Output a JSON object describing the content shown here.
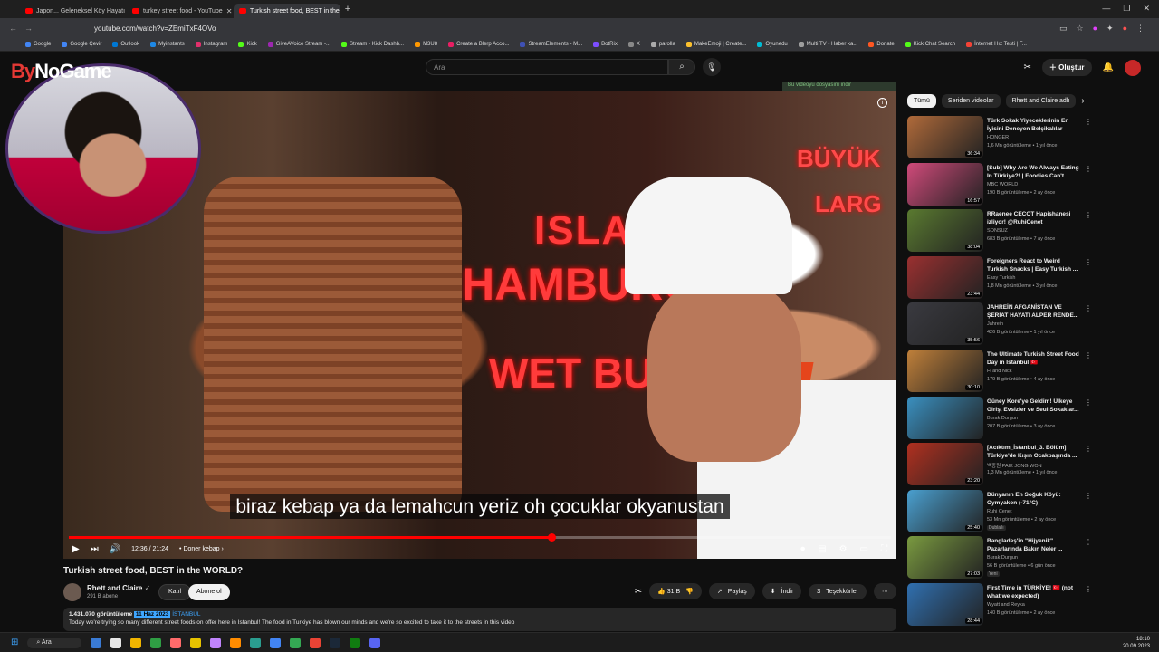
{
  "browser": {
    "tabs": [
      {
        "label": "Japon... Geleneksel Köy Hayatı",
        "active": false
      },
      {
        "label": "turkey street food - YouTube",
        "active": false
      },
      {
        "label": "Turkish street food, BEST in the",
        "active": true
      }
    ],
    "new_tab": "+",
    "url": "youtube.com/watch?v=ZEmiTxF4OVo",
    "bookmarks": [
      "Google",
      "Google Çevir",
      "Outlook",
      "Myinstants",
      "Instagram",
      "Kick",
      "GiveAVoice Stream -...",
      "Stream - Kick Dashb...",
      "M3U8",
      "Create a Blerp Acco...",
      "StreamElements - M...",
      "BotRix",
      "X",
      "parolla",
      "MakeEmoji | Create...",
      "Oyunedu",
      "Multi TV - Haber ka...",
      "Donate",
      "Kick Chat Search",
      "İnternet Hız Testi | F..."
    ]
  },
  "overlay": {
    "logo_prefix": "By",
    "logo_suffix": "NoGame"
  },
  "header": {
    "search_placeholder": "Ara",
    "create_label": "Oluştur"
  },
  "player": {
    "download_notice": "Bu videoyu dosyasını indir",
    "subtitle": "biraz kebap ya da lemahcun yeriz oh çocuklar okyanustan",
    "time": "12:36 / 21:24",
    "chapter": "Doner kebap",
    "progress": 0.587,
    "signs": [
      "ISLAK",
      "HAMBURG",
      "WET BURG",
      "BÜYÜK",
      "LARG"
    ]
  },
  "video": {
    "title": "Turkish street food, BEST in the WORLD?",
    "channel": "Rhett and Claire",
    "subscribers": "291 B abone",
    "join_label": "Katıl",
    "subscribe_label": "Abone ol",
    "likes": "31 B",
    "share_label": "Paylaş",
    "download_label": "İndir",
    "thanks_label": "Teşekkürler",
    "views": "1.431.070 görüntüleme",
    "date": "11 Haz 2023",
    "hashtag": "İSTANBUL",
    "description": "Today we're trying so many different street foods on offer here in Istanbul! The food in Turkiye has blown our minds and we're so excited to take it to the streets in this video"
  },
  "sidebar": {
    "chips": [
      "Tümü",
      "Seriden videolar",
      "Rhett and Claire adlı"
    ],
    "videos": [
      {
        "title": "Türk Sokak Yiyeceklerinin En İyisini Deneyen Belçikalılar",
        "channel": "HONGER",
        "meta": "1,6 Mn görüntüleme • 1 yıl önce",
        "duration": "36:34",
        "color": "#b06a3a"
      },
      {
        "title": "[Sub] Why Are We Always Eating In Türkiye?! | Foodies Can't ...",
        "channel": "MBC WORLD",
        "meta": "190 B görüntüleme • 2 ay önce",
        "duration": "16:57",
        "color": "#d04a7a"
      },
      {
        "title": "RRaenee CECOT Hapishanesi izliyor! @RuhiCenet",
        "channel": "SONSUZ",
        "meta": "683 B görüntüleme • 7 ay önce",
        "duration": "38:04",
        "color": "#5a7a30"
      },
      {
        "title": "Foreigners React to Weird Turkish Snacks | Easy Turkish ...",
        "channel": "Easy Turkish",
        "meta": "1,8 Mn görüntüleme • 3 yıl önce",
        "duration": "23:44",
        "color": "#9a3030"
      },
      {
        "title": "JAHREİN AFGANİSTAN VE ŞERİAT HAYATI ALPER RENDE...",
        "channel": "Jahrein",
        "meta": "426 B görüntüleme • 1 yıl önce",
        "duration": "35:56",
        "color": "#3a3a40"
      },
      {
        "title": "The Ultimate Turkish Street Food Day in Istanbul 🇹🇷",
        "channel": "Fi and Nick",
        "meta": "179 B görüntüleme • 4 ay önce",
        "duration": "30:10",
        "color": "#c0803a"
      },
      {
        "title": "Güney Kore'ye Geldim! Ülkeye Giriş, Evsizler ve Seul Sokaklar...",
        "channel": "Burak Durgun",
        "meta": "207 B görüntüleme • 3 ay önce",
        "duration": "",
        "color": "#3a90c0"
      },
      {
        "title": "[Acıktım_İstanbul_3. Bölüm] Türkiye'de Kışın Ocakbaşında ...",
        "channel": "백종원 PAIK JONG WON",
        "meta": "1,3 Mn görüntüleme • 1 yıl önce",
        "duration": "23:20",
        "color": "#b03020"
      },
      {
        "title": "Dünyanın En Soğuk Köyü: Oymyakon (-71°C)",
        "channel": "Ruhi Çenet",
        "meta": "53 Mn görüntüleme • 2 ay önce",
        "duration": "25:40",
        "color": "#4aa0d0",
        "badge": "Dublajlı"
      },
      {
        "title": "Bangladeş'in \"Hijyenik\" Pazarlarında Bakın Neler ...",
        "channel": "Burak Durgun",
        "meta": "56 B görüntüleme • 6 gün önce",
        "duration": "27:03",
        "color": "#7a9a40",
        "badge": "Yeni"
      },
      {
        "title": "First Time in TÜRKİYE! 🇹🇷 (not what we expected)",
        "channel": "Wyatt and Reyka",
        "meta": "140 B görüntüleme • 2 ay önce",
        "duration": "28:44",
        "color": "#3070b0"
      }
    ]
  },
  "taskbar": {
    "search_label": "Ara",
    "time": "18:10",
    "date": "20.09.2023",
    "icon_colors": [
      "#3a7bd5",
      "#e6e6e6",
      "#f0b400",
      "#2f9e44",
      "#ff6b6b",
      "#e6c200",
      "#c084fc",
      "#ff8c00",
      "#2a9d8f",
      "#4285f4",
      "#34a853",
      "#ea4335",
      "#1b2838",
      "#107c10",
      "#5865f2"
    ]
  }
}
